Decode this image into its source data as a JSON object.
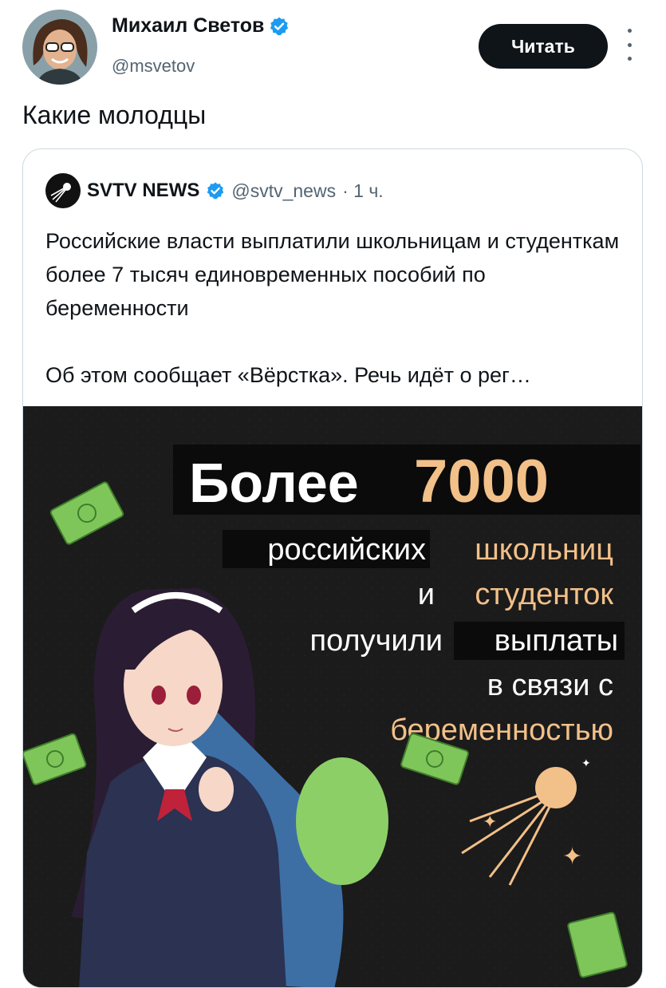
{
  "author": {
    "name": "Михаил Светов",
    "handle": "@msvetov"
  },
  "follow_label": "Читать",
  "tweet_text": "Какие молодцы",
  "quoted": {
    "name": "SVTV NEWS",
    "handle": "@svtv_news",
    "time": "· 1 ч.",
    "paragraph1": "Российские власти выплатили школьницам и студенткам более 7 тысяч единовременных пособий по беременности",
    "paragraph2": "Об этом сообщает «Вёрстка». Речь идёт о рег…"
  },
  "media": {
    "headline_word": "Более",
    "headline_number": "7000",
    "line1_a": "российских",
    "line1_b": "школьниц",
    "line2_a": "и",
    "line2_b": "студенток",
    "line3_a": "получили",
    "line3_b": "выплаты",
    "line4": "в связи с",
    "line5": "беременностью"
  },
  "colors": {
    "verified": "#1d9bf0",
    "accent_gold": "#f2c089",
    "button_bg": "#0f1419",
    "media_bg": "#1a1a1a"
  }
}
